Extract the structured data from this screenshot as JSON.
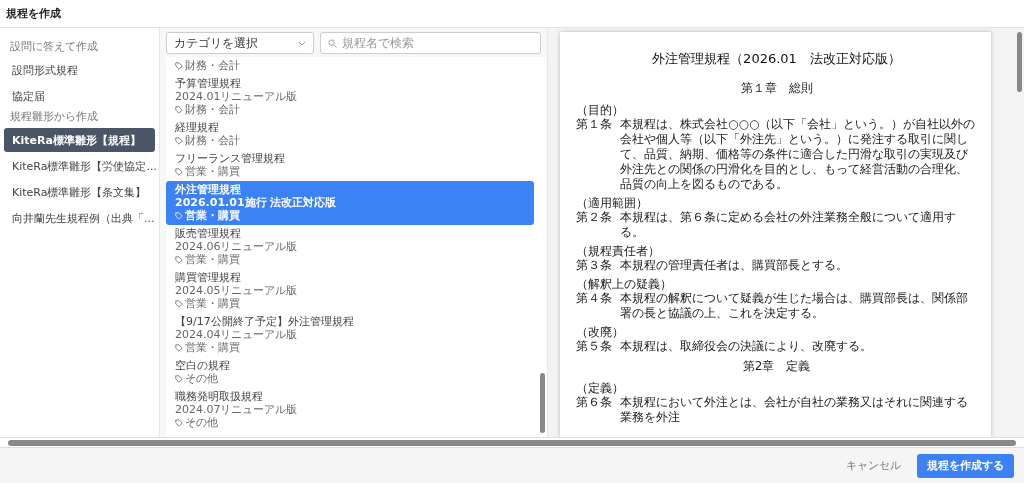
{
  "window": {
    "title": "規程を作成"
  },
  "sidebar": {
    "groups": [
      {
        "label": "設問に答えて作成",
        "items": [
          {
            "label": "設問形式規程",
            "selected": false
          },
          {
            "label": "協定届",
            "selected": false
          }
        ]
      },
      {
        "label": "規程雛形から作成",
        "items": [
          {
            "label": "KiteRa標準雛形【規程】",
            "selected": true
          },
          {
            "label": "KiteRa標準雛形【労使協定...",
            "selected": false
          },
          {
            "label": "KiteRa標準雛形【条文集】",
            "selected": false
          },
          {
            "label": "向井蘭先生規程例（出典「...",
            "selected": false
          }
        ]
      }
    ]
  },
  "filters": {
    "category": {
      "value": "カテゴリを選択"
    },
    "search": {
      "placeholder": "規程名で検索"
    }
  },
  "templates": [
    {
      "tag": "財務・会計",
      "selected": false
    },
    {
      "title": "予算管理規程",
      "version": "2024.01リニューアル版",
      "tag": "財務・会計",
      "selected": false
    },
    {
      "title": "経理規程",
      "tag": "財務・会計",
      "selected": false
    },
    {
      "title": "フリーランス管理規程",
      "tag": "営業・購買",
      "selected": false
    },
    {
      "title": "外注管理規程",
      "version": "2026.01.01施行 法改正対応版",
      "tag": "営業・購買",
      "selected": true
    },
    {
      "title": "販売管理規程",
      "version": "2024.06リニューアル版",
      "tag": "営業・購買",
      "selected": false
    },
    {
      "title": "購買管理規程",
      "version": "2024.05リニューアル版",
      "tag": "営業・購買",
      "selected": false
    },
    {
      "title": "【9/17公開終了予定】外注管理規程",
      "version": "2024.04リニューアル版",
      "tag": "営業・購買",
      "selected": false
    },
    {
      "title": "空白の規程",
      "tag": "その他",
      "selected": false
    },
    {
      "title": "職務発明取扱規程",
      "version": "2024.07リニューアル版",
      "tag": "その他",
      "selected": false
    }
  ],
  "document": {
    "title": "外注管理規程（2026.01　法改正対応版）",
    "chapters": [
      {
        "heading": "第１章　総則",
        "articles": [
          {
            "caption": "（目的）",
            "number": "第１条",
            "text": "本規程は、株式会社○○○（以下「会社」という。）が自社以外の会社や個人等（以下「外注先」という。）に発注する取引に関して、品質、納期、価格等の条件に適合した円滑な取引の実現及び外注先との関係の円滑化を目的とし、もって経営活動の合理化、品質の向上を図るものである。"
          },
          {
            "caption": "（適用範囲）",
            "number": "第２条",
            "text": "本規程は、第６条に定める会社の外注業務全般について適用する。"
          },
          {
            "caption": "（規程責任者）",
            "number": "第３条",
            "text": "本規程の管理責任者は、購買部長とする。"
          },
          {
            "caption": "（解釈上の疑義）",
            "number": "第４条",
            "text": "本規程の解釈について疑義が生じた場合は、購買部長は、関係部署の長と協議の上、これを決定する。"
          },
          {
            "caption": "（改廃）",
            "number": "第５条",
            "text": "本規程は、取締役会の決議により、改廃する。"
          }
        ]
      },
      {
        "heading": "第2章　定義",
        "articles": [
          {
            "caption": "（定義）",
            "number": "第６条",
            "text": "本規程において外注とは、会社が自社の業務又はそれに関連する業務を外注"
          }
        ]
      }
    ]
  },
  "footer": {
    "cancel": "キャンセル",
    "submit": "規程を作成する"
  }
}
